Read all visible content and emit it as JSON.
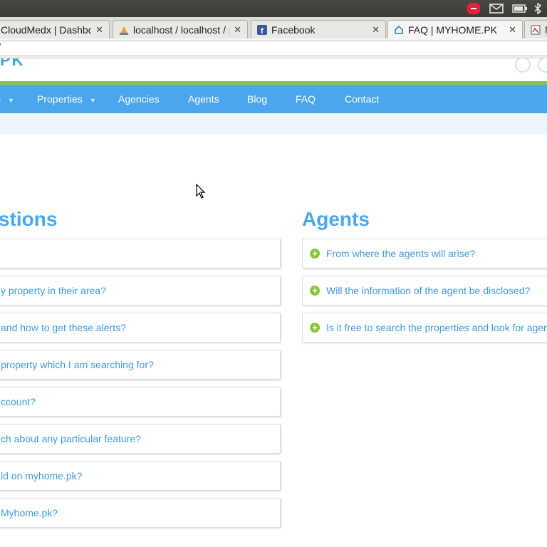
{
  "browser": {
    "tabs": [
      {
        "title": "CloudMedx | Dashboard",
        "favicon": "cloudmedx-icon"
      },
      {
        "title": "localhost / localhost / ph",
        "favicon": "phpmyadmin-icon"
      },
      {
        "title": "Facebook",
        "favicon": "facebook-icon"
      },
      {
        "title": "FAQ | MYHOME.PK",
        "favicon": "home-icon"
      },
      {
        "title": "N",
        "favicon": "page-icon"
      }
    ],
    "address": "/"
  },
  "site": {
    "logo_fragment": "PK",
    "nav": [
      {
        "label": "s"
      },
      {
        "label": "Properties"
      },
      {
        "label": "Agencies"
      },
      {
        "label": "Agents"
      },
      {
        "label": "Blog"
      },
      {
        "label": "FAQ"
      },
      {
        "label": "Contact"
      }
    ]
  },
  "faq": {
    "left_heading": "stions",
    "left_items": [
      "",
      "y property in their area?",
      "and how to get these alerts?",
      "property which I am searching for?",
      "ccount?",
      "ch about any particular feature?",
      "ld on myhome.pk?",
      "Myhome.pk?"
    ],
    "right_heading": "Agents",
    "right_items": [
      "From where the agents will arise?",
      "Will the information of the agent be disclosed?",
      "Is it free to search the properties and look for agen"
    ]
  },
  "colors": {
    "accent_blue": "#4ba6f0",
    "accent_green": "#8cc63f",
    "link_blue": "#3d9ae2"
  }
}
